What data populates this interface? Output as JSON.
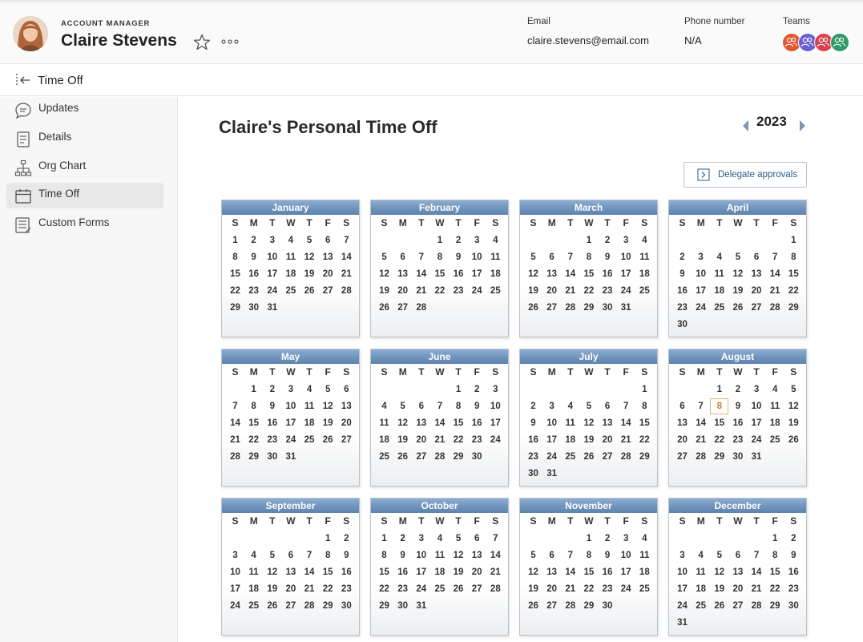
{
  "profile": {
    "role": "ACCOUNT MANAGER",
    "name": "Claire Stevens",
    "email_label": "Email",
    "email_value": "claire.stevens@email.com",
    "phone_label": "Phone number",
    "phone_value": "N/A",
    "teams_label": "Teams",
    "team_colors": [
      "#e2572d",
      "#6b5fd6",
      "#d9414c",
      "#2f9a6a"
    ]
  },
  "subheader": {
    "title": "Time Off"
  },
  "sidebar": {
    "items": [
      {
        "label": "Updates",
        "icon": "speech-bubble-icon",
        "active": false
      },
      {
        "label": "Details",
        "icon": "document-icon",
        "active": false
      },
      {
        "label": "Org Chart",
        "icon": "org-chart-icon",
        "active": false
      },
      {
        "label": "Time Off",
        "icon": "calendar-icon",
        "active": true
      },
      {
        "label": "Custom Forms",
        "icon": "form-icon",
        "active": false
      }
    ]
  },
  "main": {
    "title": "Claire's Personal Time Off",
    "year": "2023",
    "delegate_label": "Delegate approvals"
  },
  "calendar": {
    "weekday_headers": [
      "S",
      "M",
      "T",
      "W",
      "T",
      "F",
      "S"
    ],
    "highlighted": {
      "month": 8,
      "day": 8
    },
    "months": [
      {
        "name": "January",
        "first_weekday": 0,
        "days": 31
      },
      {
        "name": "February",
        "first_weekday": 3,
        "days": 28
      },
      {
        "name": "March",
        "first_weekday": 3,
        "days": 31
      },
      {
        "name": "April",
        "first_weekday": 6,
        "days": 30
      },
      {
        "name": "May",
        "first_weekday": 1,
        "days": 31
      },
      {
        "name": "June",
        "first_weekday": 4,
        "days": 30
      },
      {
        "name": "July",
        "first_weekday": 6,
        "days": 31
      },
      {
        "name": "August",
        "first_weekday": 2,
        "days": 31
      },
      {
        "name": "September",
        "first_weekday": 5,
        "days": 30
      },
      {
        "name": "October",
        "first_weekday": 0,
        "days": 31
      },
      {
        "name": "November",
        "first_weekday": 3,
        "days": 30
      },
      {
        "name": "December",
        "first_weekday": 5,
        "days": 31
      }
    ]
  },
  "colors": {
    "month_header": "#6f93bc",
    "today_border": "#e7b27a",
    "today_text": "#d97a1e",
    "link": "#2d5a86"
  }
}
